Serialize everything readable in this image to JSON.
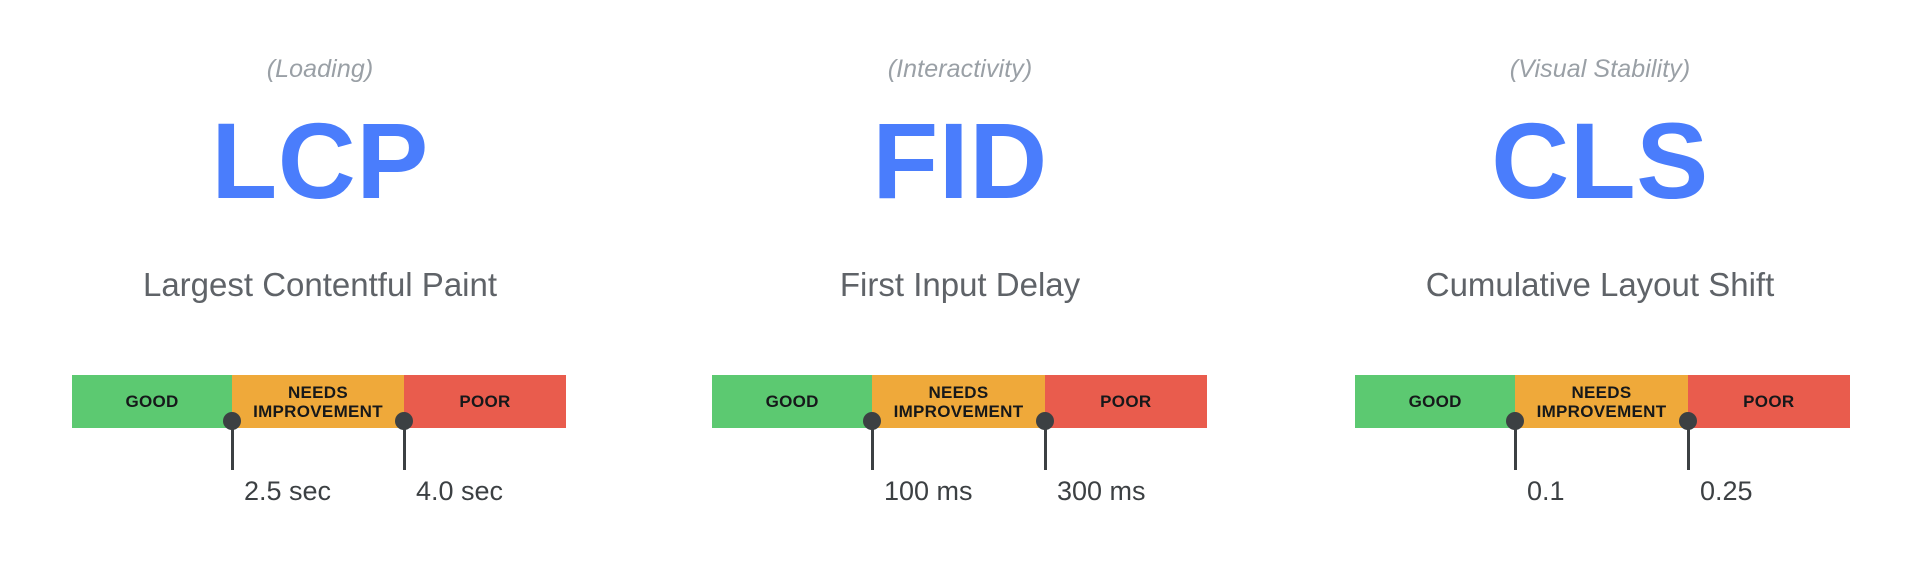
{
  "page": {
    "background_color": "#ffffff",
    "accent_color": "#4a7dfc",
    "muted_text_color": "#5f6368",
    "category_text_color": "#9aa0a6",
    "marker_color": "#3c4043"
  },
  "legend": {
    "good_label": "GOOD",
    "needs_improvement_label": "NEEDS\nIMPROVEMENT",
    "poor_label": "POOR",
    "good_color": "#5cc971",
    "needs_improvement_color": "#efa93a",
    "poor_color": "#e95c4d"
  },
  "metrics": [
    {
      "id": "lcp",
      "category": "(Loading)",
      "acronym": "LCP",
      "full_name": "Largest Contentful Paint",
      "thresholds": [
        {
          "value": "2.5 sec"
        },
        {
          "value": "4.0 sec"
        }
      ]
    },
    {
      "id": "fid",
      "category": "(Interactivity)",
      "acronym": "FID",
      "full_name": "First Input Delay",
      "thresholds": [
        {
          "value": "100 ms"
        },
        {
          "value": "300 ms"
        }
      ]
    },
    {
      "id": "cls",
      "category": "(Visual Stability)",
      "acronym": "CLS",
      "full_name": "Cumulative Layout Shift",
      "thresholds": [
        {
          "value": "0.1"
        },
        {
          "value": "0.25"
        }
      ]
    }
  ],
  "chart_data": {
    "type": "bar",
    "title": "Core Web Vitals thresholds",
    "xlabel": "",
    "ylabel": "",
    "orientation": "horizontal",
    "categories": [
      "GOOD",
      "NEEDS IMPROVEMENT",
      "POOR"
    ],
    "segment_colors": [
      "#5cc971",
      "#efa93a",
      "#e95c4d"
    ],
    "segment_fractions": [
      0.324,
      0.348,
      0.328
    ],
    "series": [
      {
        "name": "LCP",
        "subtitle": "Largest Contentful Paint",
        "group": "(Loading)",
        "unit": "sec",
        "boundaries": [
          2.5,
          4.0
        ],
        "boundary_labels": [
          "2.5 sec",
          "4.0 sec"
        ],
        "ranges": [
          {
            "label": "GOOD",
            "from": 0,
            "to": 2.5
          },
          {
            "label": "NEEDS IMPROVEMENT",
            "from": 2.5,
            "to": 4.0
          },
          {
            "label": "POOR",
            "from": 4.0,
            "to": null
          }
        ]
      },
      {
        "name": "FID",
        "subtitle": "First Input Delay",
        "group": "(Interactivity)",
        "unit": "ms",
        "boundaries": [
          100,
          300
        ],
        "boundary_labels": [
          "100 ms",
          "300 ms"
        ],
        "ranges": [
          {
            "label": "GOOD",
            "from": 0,
            "to": 100
          },
          {
            "label": "NEEDS IMPROVEMENT",
            "from": 100,
            "to": 300
          },
          {
            "label": "POOR",
            "from": 300,
            "to": null
          }
        ]
      },
      {
        "name": "CLS",
        "subtitle": "Cumulative Layout Shift",
        "group": "(Visual Stability)",
        "unit": "",
        "boundaries": [
          0.1,
          0.25
        ],
        "boundary_labels": [
          "0.1",
          "0.25"
        ],
        "ranges": [
          {
            "label": "GOOD",
            "from": 0,
            "to": 0.1
          },
          {
            "label": "NEEDS IMPROVEMENT",
            "from": 0.1,
            "to": 0.25
          },
          {
            "label": "POOR",
            "from": 0.25,
            "to": null
          }
        ]
      }
    ],
    "legend_position": "inside-bars",
    "grid": false
  }
}
